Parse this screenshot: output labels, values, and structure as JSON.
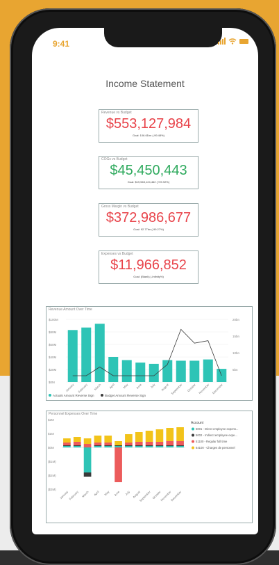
{
  "status": {
    "time": "9:41"
  },
  "report": {
    "title": "Income Statement"
  },
  "kpis": [
    {
      "label": "Revenue vs Budget",
      "value": "$553,127,984",
      "goal": "Goal: 106.61bn (-99.48%)",
      "color": "#e8434a"
    },
    {
      "label": "COGs vs Budget",
      "value": "$45,450,443",
      "goal": "Goal: $19,563,124,462 (+99.92%)",
      "color": "#2faa5e"
    },
    {
      "label": "Gross Margin vs Budget",
      "value": "$372,986,677",
      "goal": "Goal: 92.77bn (-99.27%)",
      "color": "#e8434a"
    },
    {
      "label": "Expenses vs Budget",
      "value": "$11,966,852",
      "goal": "Goal: (Blank) (-Infinity%)",
      "color": "#e8434a"
    }
  ],
  "colors": {
    "teal": "#2ec4b6",
    "dark": "#3a3a3a",
    "red": "#ec5b5b",
    "yellow": "#f2c31a",
    "orange": "#e8a531"
  },
  "chart_data": [
    {
      "type": "bar",
      "title": "Revenue Amount Over Time",
      "categories": [
        "January",
        "February",
        "March",
        "April",
        "May",
        "June",
        "July",
        "August",
        "September",
        "October",
        "November",
        "December"
      ],
      "series": [
        {
          "name": "Actuals Amount Reverse Sign",
          "values": [
            83,
            87,
            93,
            40,
            35,
            31,
            29,
            35,
            34,
            34,
            36,
            21
          ]
        },
        {
          "name": "Budget Amount Reverse Sign",
          "values": [
            2.5,
            2.5,
            6,
            2.5,
            2.5,
            2.5,
            2.5,
            7,
            21,
            15.5,
            16.5,
            2.5
          ]
        }
      ],
      "yticks_left": [
        "$100M",
        "$80M",
        "$60M",
        "$40M",
        "$20M",
        "$0M"
      ],
      "yticks_right": [
        "20bn",
        "15bn",
        "10bn",
        "5bn"
      ],
      "ylim": [
        0,
        100
      ],
      "y2lim": [
        0,
        25
      ],
      "legend": "bottom-left"
    },
    {
      "type": "bar",
      "title": "Personnel Expenses Over Time",
      "categories": [
        "January",
        "February",
        "March",
        "April",
        "May",
        "June",
        "July",
        "August",
        "September",
        "October",
        "November",
        "December"
      ],
      "series": [
        {
          "name": "5001 - Direct employee expens...",
          "values": [
            0.1,
            0.1,
            -1.8,
            0.1,
            0.1,
            0.1,
            0.1,
            0.1,
            0.1,
            0.1,
            0.1,
            0.1
          ]
        },
        {
          "name": "5002 - Indirect employee expe...",
          "values": [
            0.05,
            0.05,
            -0.3,
            0.05,
            0.05,
            0.05,
            0.05,
            0.05,
            0.05,
            0.05,
            0.05,
            0.05
          ]
        },
        {
          "name": "51100 - Regular full time",
          "values": [
            0.2,
            0.25,
            0.25,
            0.2,
            0.2,
            -2.5,
            0.2,
            0.25,
            0.25,
            0.25,
            0.3,
            0.3
          ]
        },
        {
          "name": "64100 - Charges de personnel",
          "values": [
            0.3,
            0.35,
            0.4,
            0.5,
            0.5,
            0.3,
            0.6,
            0.7,
            0.8,
            0.9,
            0.95,
            1.0
          ]
        }
      ],
      "yticks": [
        "$2M",
        "$1M",
        "$0M",
        "($1M)",
        "($2M)",
        "($3M)"
      ],
      "ylim": [
        -3,
        2
      ],
      "legend_title": "Account",
      "legend": "right"
    }
  ]
}
